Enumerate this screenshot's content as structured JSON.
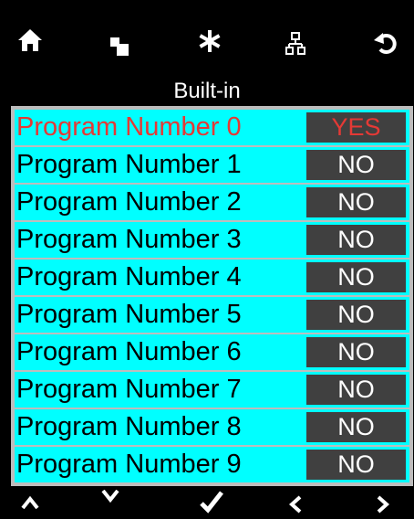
{
  "toolbar": {
    "icons": [
      "home-icon",
      "copy-icon",
      "asterisk-icon",
      "network-icon",
      "undo-icon"
    ]
  },
  "screen": {
    "title": "Built-in"
  },
  "programs": [
    {
      "label": "Program Number 0",
      "value": "YES",
      "active": true
    },
    {
      "label": "Program Number 1",
      "value": "NO",
      "active": false
    },
    {
      "label": "Program Number 2",
      "value": "NO",
      "active": false
    },
    {
      "label": "Program Number 3",
      "value": "NO",
      "active": false
    },
    {
      "label": "Program Number 4",
      "value": "NO",
      "active": false
    },
    {
      "label": "Program Number 5",
      "value": "NO",
      "active": false
    },
    {
      "label": "Program Number 6",
      "value": "NO",
      "active": false
    },
    {
      "label": "Program Number 7",
      "value": "NO",
      "active": false
    },
    {
      "label": "Program Number 8",
      "value": "NO",
      "active": false
    },
    {
      "label": "Program Number 9",
      "value": "NO",
      "active": false
    }
  ],
  "nav": {
    "icons": [
      "up-arrow-icon",
      "down-arrow-icon",
      "checkmark-icon",
      "left-arrow-icon",
      "right-arrow-icon"
    ]
  },
  "colors": {
    "row_background": "#00ffff",
    "value_background": "#404040",
    "active_text": "#e53935"
  }
}
